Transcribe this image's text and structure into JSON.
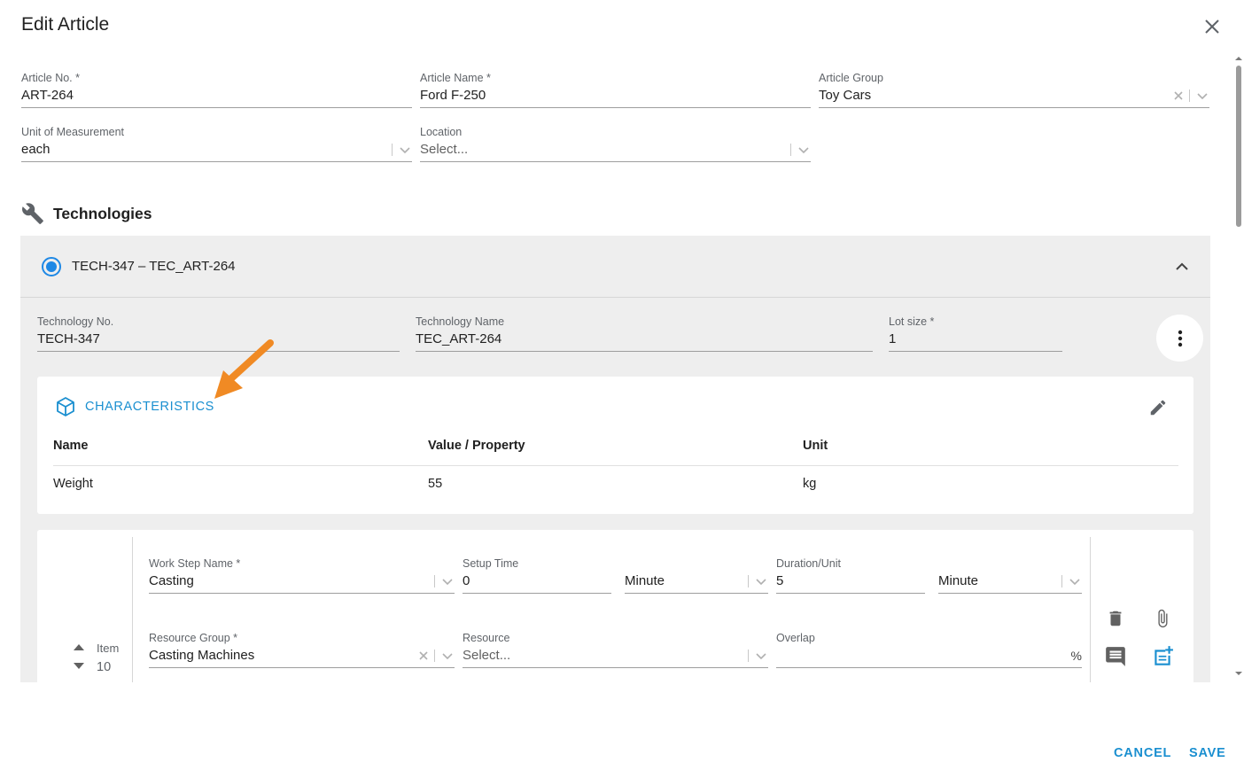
{
  "dialog": {
    "title": "Edit Article",
    "cancel_label": "CANCEL",
    "save_label": "SAVE"
  },
  "article": {
    "article_no": {
      "label": "Article No. *",
      "value": "ART-264"
    },
    "article_name": {
      "label": "Article Name *",
      "value": "Ford F-250"
    },
    "article_group": {
      "label": "Article Group",
      "value": "Toy Cars"
    },
    "unit": {
      "label": "Unit of Measurement",
      "value": "each"
    },
    "location": {
      "label": "Location",
      "placeholder": "Select..."
    }
  },
  "technologies": {
    "heading": "Technologies",
    "item": {
      "title": "TECH-347 – TEC_ART-264",
      "tech_no": {
        "label": "Technology No.",
        "value": "TECH-347"
      },
      "tech_name": {
        "label": "Technology Name",
        "value": "TEC_ART-264"
      },
      "lot_size": {
        "label": "Lot size *",
        "value": "1"
      },
      "characteristics": {
        "heading": "CHARACTERISTICS",
        "columns": [
          "Name",
          "Value / Property",
          "Unit"
        ],
        "rows": [
          {
            "name": "Weight",
            "value": "55",
            "unit": "kg"
          }
        ]
      },
      "work_step": {
        "item_label": "Item",
        "item_number": "10",
        "name": {
          "label": "Work Step Name *",
          "value": "Casting"
        },
        "setup_time": {
          "label": "Setup Time",
          "value": "0",
          "unit": "Minute"
        },
        "duration": {
          "label": "Duration/Unit",
          "value": "5",
          "unit": "Minute"
        },
        "resource_group": {
          "label": "Resource Group *",
          "value": "Casting Machines"
        },
        "resource": {
          "label": "Resource",
          "placeholder": "Select..."
        },
        "overlap": {
          "label": "Overlap",
          "suffix": "%"
        }
      }
    }
  },
  "colors": {
    "accent": "#1a8fd0",
    "radio": "#1e88e5",
    "panel": "#eeeeee",
    "annotation_arrow": "#f08a24"
  }
}
